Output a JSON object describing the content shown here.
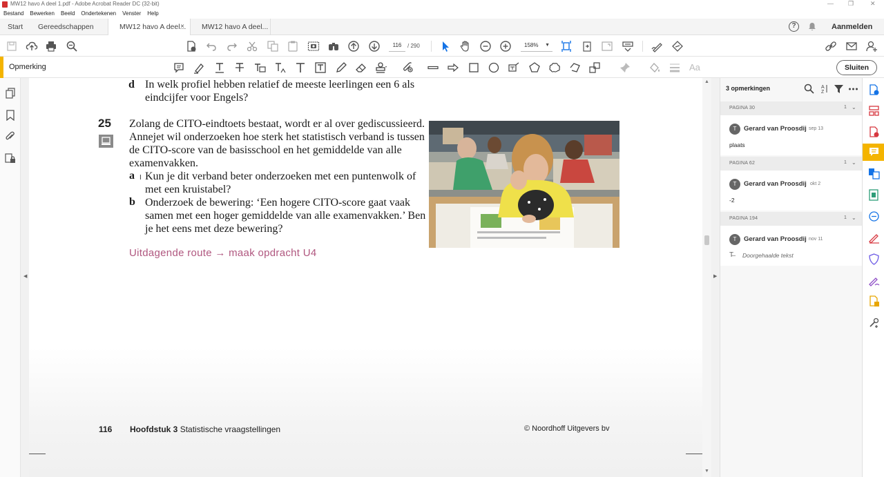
{
  "window": {
    "title": "MW12 havo A deel 1.pdf - Adobe Acrobat Reader DC (32-bit)",
    "minimize": "—",
    "maximize": "❐",
    "close": "✕"
  },
  "menu": [
    "Bestand",
    "Bewerken",
    "Beeld",
    "Ondertekenen",
    "Venster",
    "Help"
  ],
  "tabs": {
    "home": "Start",
    "tools": "Gereedschappen",
    "doc1": "MW12 havo A deel...",
    "doc2": "MW12 havo A deel...",
    "close_glyph": "×",
    "help_glyph": "?",
    "signin": "Aanmelden"
  },
  "toolbar": {
    "current_page": "116",
    "total_pages": "/ 290",
    "zoom": "158%"
  },
  "commentbar": {
    "label": "Opmerking",
    "close_label": "Sluiten"
  },
  "document": {
    "prev_item": {
      "letter": "d",
      "text": "In welk profiel hebben relatief de meeste leerlingen een 6 als eindcijfer voor Engels?"
    },
    "question": {
      "number": "25",
      "intro": "Zolang de CITO-eindtoets bestaat, wordt er al over gediscussieerd. Annejet wil onderzoeken hoe sterk het statistisch verband is tussen de CITO-score van de basisschool en het gemiddelde van alle examenvakken.",
      "parts": [
        {
          "letter": "a",
          "text": "Kun je dit verband beter onderzoeken met een puntenwolk of met een kruistabel?"
        },
        {
          "letter": "b",
          "text": "Onderzoek de bewering: ‘Een hogere CITO-score gaat vaak samen met een hoger gemiddelde van alle examenvakken.’ Ben je het eens met deze bewering?"
        }
      ]
    },
    "route": "Uitdagende route → maak opdracht U4",
    "footer": {
      "page": "116",
      "chapter_bold": "Hoofdstuk 3",
      "chapter_title": "Statistische vraagstellingen",
      "copyright": "© Noordhoff Uitgevers bv"
    }
  },
  "comments_panel": {
    "count_label": "3 opmerkingen",
    "sections": [
      {
        "page_label": "PAGINA 30",
        "count": "1",
        "author": "Gerard van Proosdij",
        "date": "sep 13",
        "text": "plaats",
        "initial": "T"
      },
      {
        "page_label": "PAGINA 62",
        "count": "1",
        "author": "Gerard van Proosdij",
        "date": "okt 2",
        "text": "-2",
        "initial": "T"
      },
      {
        "page_label": "PAGINA 194",
        "count": "1",
        "author": "Gerard van Proosdij",
        "date": "nov 11",
        "text": "Doorgehaalde tekst",
        "initial": "T"
      }
    ]
  },
  "colors": {
    "accent": "#f4b400",
    "route": "#b0577f",
    "tool_blue": "#1473e6"
  }
}
